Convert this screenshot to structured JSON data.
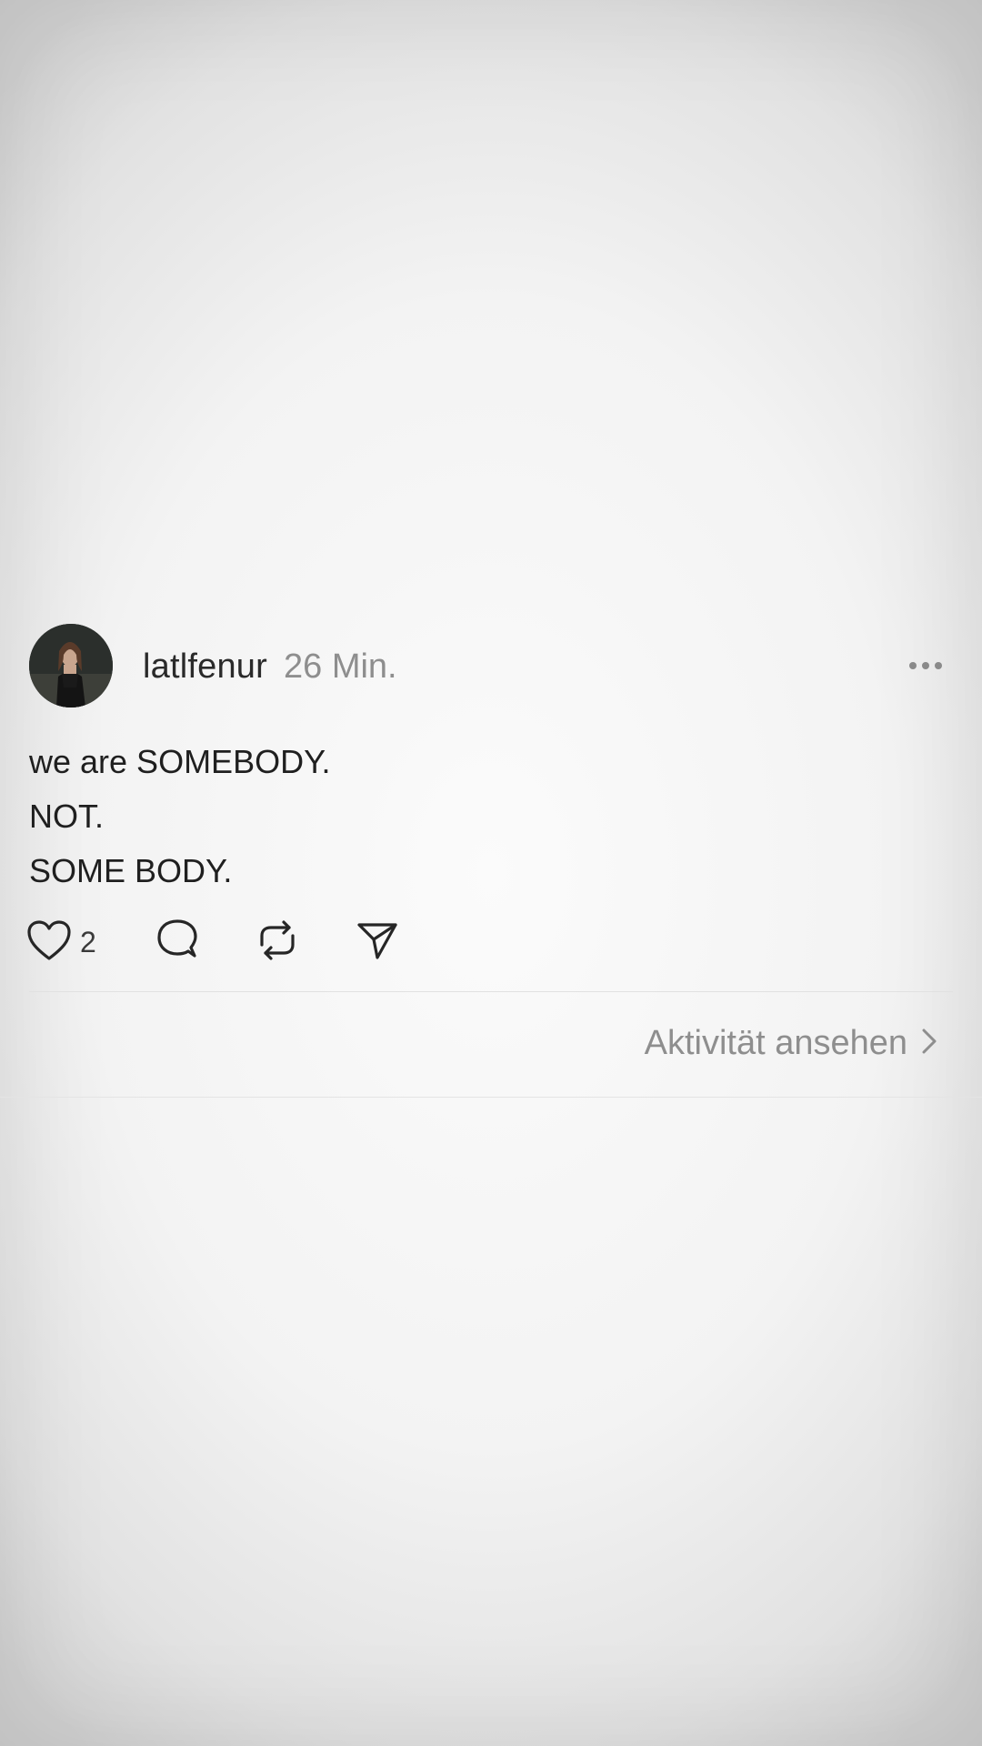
{
  "post": {
    "username": "latlfenur",
    "timestamp": "26 Min.",
    "lines": [
      "we are SOMEBODY.",
      "NOT.",
      "SOME BODY."
    ],
    "like_count": "2",
    "activity_label": "Aktivität ansehen"
  },
  "icons": {
    "more": "more-horizontal-icon",
    "like": "heart-icon",
    "comment": "comment-bubble-icon",
    "repost": "repost-icon",
    "share": "paper-plane-icon",
    "chevron": "chevron-right-icon"
  },
  "colors": {
    "text_primary": "#1f1f1f",
    "text_secondary": "#8e8e8e",
    "divider": "#e1e1e1"
  }
}
